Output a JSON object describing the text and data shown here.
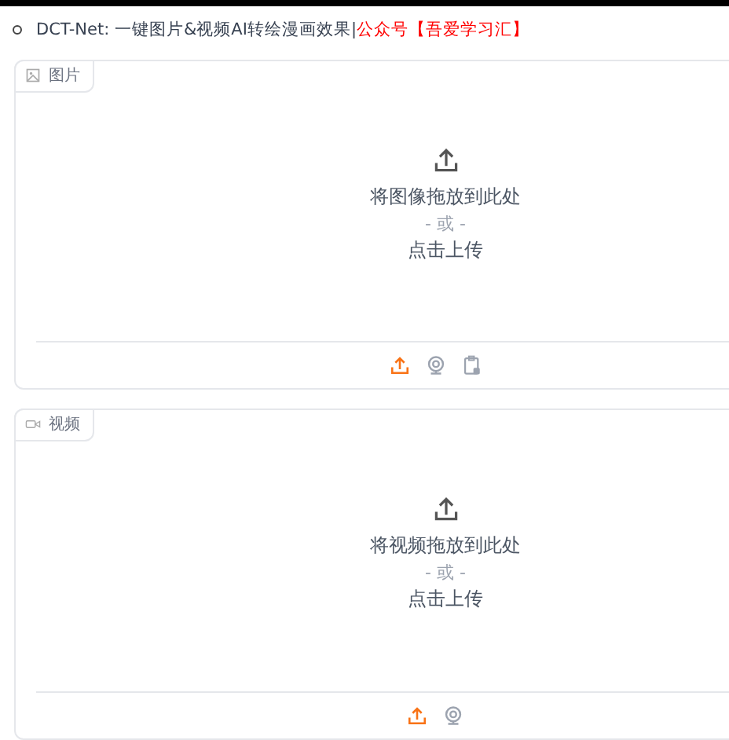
{
  "heading": {
    "title": "DCT-Net: 一键图片&视频AI转绘漫画效果",
    "separator": "|",
    "account": "公众号【吾爱学习汇】"
  },
  "panels": [
    {
      "kind": "image",
      "label": "图片",
      "drop_text": "将图像拖放到此处",
      "or_text": "- 或 -",
      "click_text": "点击上传",
      "sources": [
        {
          "kind": "upload",
          "selected": true
        },
        {
          "kind": "webcam",
          "selected": false
        },
        {
          "kind": "clipboard",
          "selected": false
        }
      ]
    },
    {
      "kind": "video",
      "label": "视频",
      "drop_text": "将视频拖放到此处",
      "or_text": "- 或 -",
      "click_text": "点击上传",
      "sources": [
        {
          "kind": "upload",
          "selected": true
        },
        {
          "kind": "webcam",
          "selected": false
        }
      ]
    }
  ]
}
